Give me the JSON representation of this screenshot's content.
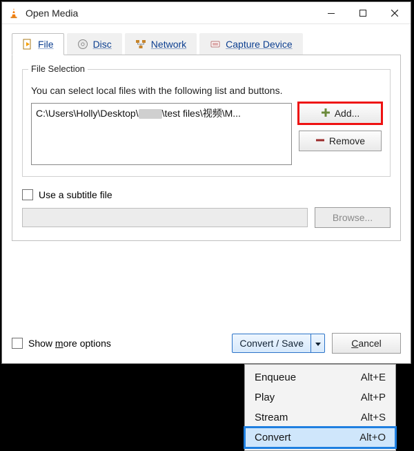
{
  "window": {
    "title": "Open Media"
  },
  "tabs": {
    "file": {
      "label": "File",
      "hotkey_index": 0
    },
    "disc": {
      "label": "Disc",
      "hotkey_index": 0
    },
    "network": {
      "label": "Network",
      "hotkey_index": 0
    },
    "capture": {
      "label": "Capture Device",
      "hotkey_index": 8
    }
  },
  "file_selection": {
    "legend": "File Selection",
    "hint": "You can select local files with the following list and buttons.",
    "files": [
      "C:\\Users\\Holly\\Desktop\\测试\\test files\\视频\\M..."
    ],
    "add_label": "Add...",
    "remove_label": "Remove"
  },
  "subtitle": {
    "checkbox_label": "Use a subtitle file",
    "browse_label": "Browse..."
  },
  "options": {
    "show_more_label_before": "Show ",
    "show_more_hotkey": "m",
    "show_more_label_after": "ore options"
  },
  "actions": {
    "convert_save_label": "Convert / Save",
    "cancel_label_before": "",
    "cancel_hotkey": "C",
    "cancel_label_after": "ancel"
  },
  "dropdown": {
    "items": [
      {
        "label": "Enqueue",
        "accel": "Alt+E",
        "selected": false
      },
      {
        "label": "Play",
        "accel": "Alt+P",
        "selected": false
      },
      {
        "label": "Stream",
        "accel": "Alt+S",
        "selected": false
      },
      {
        "label": "Convert",
        "accel": "Alt+O",
        "selected": true
      }
    ]
  },
  "icons": {
    "plus_color": "#6b8a3a",
    "minus_color": "#9a2a2a"
  }
}
